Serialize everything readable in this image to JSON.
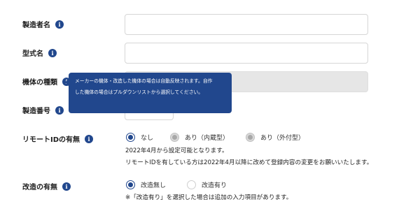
{
  "fields": {
    "maker": {
      "label": "製造者名",
      "value": ""
    },
    "model": {
      "label": "型式名",
      "value": ""
    },
    "machine_type": {
      "label": "機体の種類"
    },
    "serial": {
      "label": "製造番号"
    },
    "remote_id": {
      "label": "リモートIDの有無",
      "options": [
        "なし",
        "あり（内蔵型）",
        "あり（外付型）"
      ],
      "selected": "なし",
      "notes": [
        "2022年4月から設定可能となります。",
        "リモートIDを有している方は2022年4月以降に改めて登録内容の変更をお願いいたします。"
      ]
    },
    "modified": {
      "label": "改造の有無",
      "options": [
        "改造無し",
        "改造有り"
      ],
      "selected": "改造無し",
      "note": "※「改造有り」を選択した場合は追加の入力項目があります。"
    }
  },
  "tooltip": {
    "lines": [
      "メーカーの機体・改造した機体の場合は自動反映されます。自作",
      "した機体の場合はプルダウンリストから選択してください。"
    ]
  },
  "icons": {
    "info": "info-icon",
    "info_glyph": "i"
  },
  "colors": {
    "accent": "#21478d",
    "field_border": "#d6d6d6",
    "disabled_fill": "#e6e6e6"
  }
}
